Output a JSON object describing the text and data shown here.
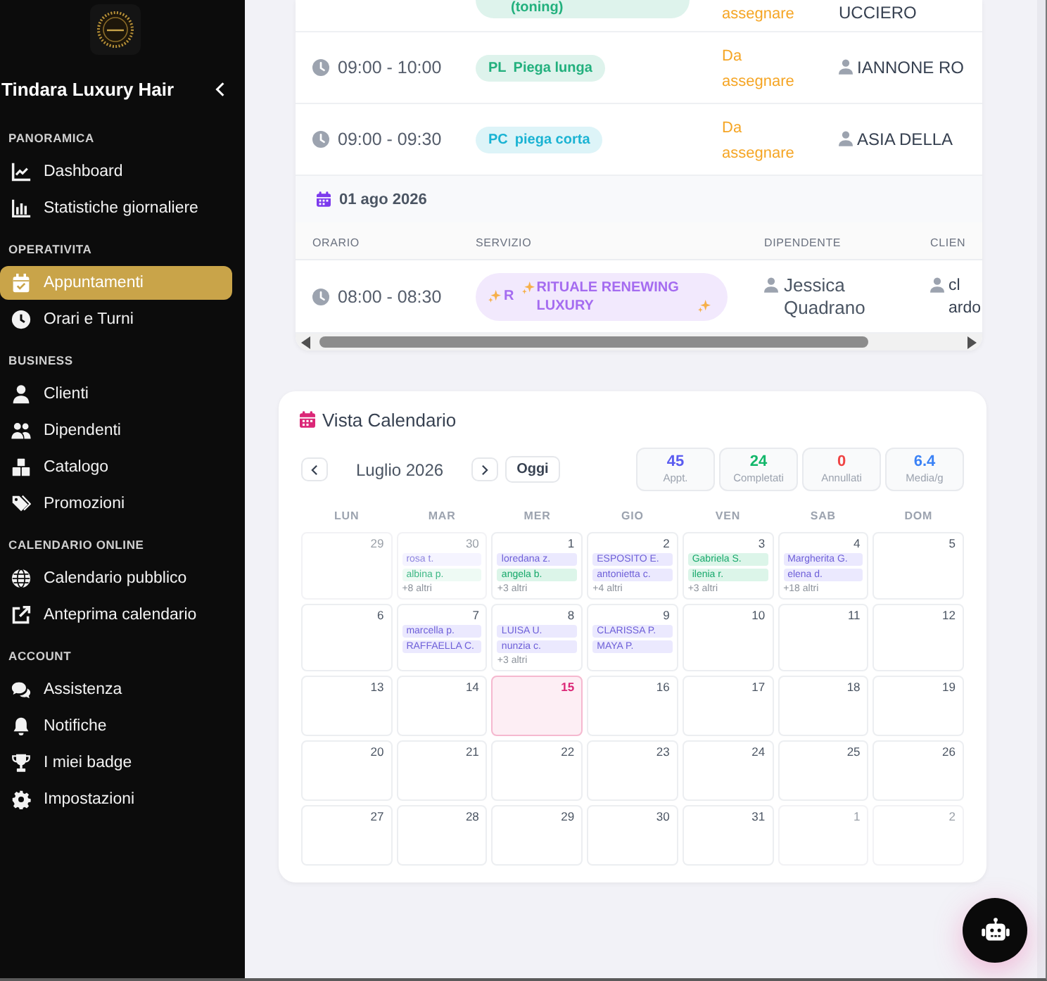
{
  "sidebar": {
    "brand": "Tindara Luxury Hair",
    "sections": [
      {
        "title": "PANORAMICA",
        "items": [
          {
            "label": "Dashboard",
            "selected": false
          },
          {
            "label": "Statistiche giornaliere",
            "selected": false
          }
        ]
      },
      {
        "title": "OPERATIVITA",
        "items": [
          {
            "label": "Appuntamenti",
            "selected": true
          },
          {
            "label": "Orari e Turni",
            "selected": false
          }
        ]
      },
      {
        "title": "BUSINESS",
        "items": [
          {
            "label": "Clienti",
            "selected": false
          },
          {
            "label": "Dipendenti",
            "selected": false
          },
          {
            "label": "Catalogo",
            "selected": false
          },
          {
            "label": "Promozioni",
            "selected": false
          }
        ]
      },
      {
        "title": "CALENDARIO ONLINE",
        "items": [
          {
            "label": "Calendario pubblico",
            "selected": false
          },
          {
            "label": "Anteprima calendario",
            "selected": false
          }
        ]
      },
      {
        "title": "ACCOUNT",
        "items": [
          {
            "label": "Assistenza",
            "selected": false
          },
          {
            "label": "Notifiche",
            "selected": false
          },
          {
            "label": "I miei badge",
            "selected": false
          },
          {
            "label": "Impostazioni",
            "selected": false
          }
        ]
      }
    ]
  },
  "appointments": {
    "groups": [
      {
        "rows": [
          {
            "kind": "cut",
            "service": {
              "name": "(toning)",
              "color": "#22b07d"
            },
            "staff": {
              "name": "assegnare",
              "assigned": false
            },
            "client": "UCCIERO"
          },
          {
            "kind": "full",
            "time": "09:00 - 10:00",
            "service": {
              "code": "PL",
              "name": "Piega lunga",
              "color": "#22b07d"
            },
            "staff": {
              "name": "Da assegnare",
              "assigned": false
            },
            "client": "IANNONE RO"
          },
          {
            "kind": "full",
            "time": "09:00 - 09:30",
            "service": {
              "code": "PC",
              "name": "piega corta",
              "color": "#1ab3d3"
            },
            "staff": {
              "name": "Da assegnare",
              "assigned": false
            },
            "client": "ASIA DELLA"
          }
        ]
      },
      {
        "date": "01 ago 2026",
        "columns": [
          "ORARIO",
          "SERVIZIO",
          "DIPENDENTE",
          "CLIEN"
        ],
        "rows": [
          {
            "kind": "full",
            "time": "08:00 - 08:30",
            "service": {
              "code": "R",
              "name": "RITUALE RENEWING LUXURY",
              "color": "#a56cf0",
              "sparkles": true
            },
            "staff": {
              "name": "Jessica Quadrano",
              "assigned": true
            },
            "client": "cl ardo"
          }
        ]
      }
    ]
  },
  "calendar": {
    "title": "Vista Calendario",
    "month": "Luglio 2026",
    "today_button": "Oggi",
    "stats": [
      {
        "value": "45",
        "label": "Appt.",
        "color": "#5b5cf0"
      },
      {
        "value": "24",
        "label": "Completati",
        "color": "#12b76a"
      },
      {
        "value": "0",
        "label": "Annullati",
        "color": "#ef4444"
      },
      {
        "value": "6.4",
        "label": "Media/g",
        "color": "#3b82f6"
      }
    ],
    "weekdays": [
      "LUN",
      "MAR",
      "MER",
      "GIO",
      "VEN",
      "SAB",
      "DOM"
    ],
    "weeks": [
      [
        {
          "day": "29",
          "outside": true,
          "today": false
        },
        {
          "day": "30",
          "outside": true,
          "today": false,
          "events": [
            {
              "name": "rosa t.",
              "completed": false
            },
            {
              "name": "albina p.",
              "completed": true
            }
          ],
          "more": "+8 altri"
        },
        {
          "day": "1",
          "outside": false,
          "today": false,
          "events": [
            {
              "name": "loredana z.",
              "completed": false
            },
            {
              "name": "angela b.",
              "completed": true
            }
          ],
          "more": "+3 altri"
        },
        {
          "day": "2",
          "outside": false,
          "today": false,
          "events": [
            {
              "name": "ESPOSITO E.",
              "completed": false
            },
            {
              "name": "antonietta c.",
              "completed": false
            }
          ],
          "more": "+4 altri"
        },
        {
          "day": "3",
          "outside": false,
          "today": false,
          "events": [
            {
              "name": "Gabriela S.",
              "completed": true
            },
            {
              "name": "ilenia r.",
              "completed": true
            }
          ],
          "more": "+3 altri"
        },
        {
          "day": "4",
          "outside": false,
          "today": false,
          "events": [
            {
              "name": "Margherita G.",
              "completed": false
            },
            {
              "name": "elena d.",
              "completed": false
            }
          ],
          "more": "+18 altri"
        },
        {
          "day": "5",
          "outside": false,
          "today": false
        }
      ],
      [
        {
          "day": "6",
          "outside": false,
          "today": false
        },
        {
          "day": "7",
          "outside": false,
          "today": false,
          "events": [
            {
              "name": "marcella p.",
              "completed": false
            },
            {
              "name": "RAFFAELLA C.",
              "completed": false
            }
          ]
        },
        {
          "day": "8",
          "outside": false,
          "today": false,
          "events": [
            {
              "name": "LUISA U.",
              "completed": false
            },
            {
              "name": "nunzia c.",
              "completed": false
            }
          ],
          "more": "+3 altri"
        },
        {
          "day": "9",
          "outside": false,
          "today": false,
          "events": [
            {
              "name": "CLARISSA P.",
              "completed": false
            },
            {
              "name": "MAYA P.",
              "completed": false
            }
          ]
        },
        {
          "day": "10",
          "outside": false,
          "today": false
        },
        {
          "day": "11",
          "outside": false,
          "today": false
        },
        {
          "day": "12",
          "outside": false,
          "today": false
        }
      ],
      [
        {
          "day": "13",
          "outside": false,
          "today": false
        },
        {
          "day": "14",
          "outside": false,
          "today": false
        },
        {
          "day": "15",
          "outside": false,
          "today": true
        },
        {
          "day": "16",
          "outside": false,
          "today": false
        },
        {
          "day": "17",
          "outside": false,
          "today": false
        },
        {
          "day": "18",
          "outside": false,
          "today": false
        },
        {
          "day": "19",
          "outside": false,
          "today": false
        }
      ],
      [
        {
          "day": "20",
          "outside": false,
          "today": false
        },
        {
          "day": "21",
          "outside": false,
          "today": false
        },
        {
          "day": "22",
          "outside": false,
          "today": false
        },
        {
          "day": "23",
          "outside": false,
          "today": false
        },
        {
          "day": "24",
          "outside": false,
          "today": false
        },
        {
          "day": "25",
          "outside": false,
          "today": false
        },
        {
          "day": "26",
          "outside": false,
          "today": false
        }
      ],
      [
        {
          "day": "27",
          "outside": false,
          "today": false
        },
        {
          "day": "28",
          "outside": false,
          "today": false
        },
        {
          "day": "29",
          "outside": false,
          "today": false
        },
        {
          "day": "30",
          "outside": false,
          "today": false
        },
        {
          "day": "31",
          "outside": false,
          "today": false
        },
        {
          "day": "1",
          "outside": true,
          "today": false
        },
        {
          "day": "2",
          "outside": true,
          "today": false
        }
      ]
    ]
  }
}
